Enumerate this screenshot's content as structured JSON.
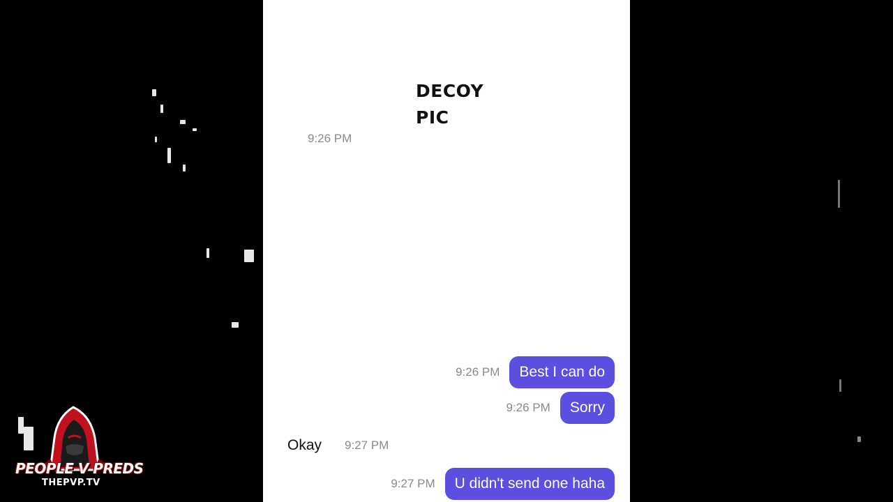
{
  "image_placeholder": {
    "line1": "DECOY",
    "line2": "PIC",
    "time": "9:26 PM"
  },
  "messages": [
    {
      "direction": "out",
      "text": "Best I can do",
      "time": "9:26 PM"
    },
    {
      "direction": "out",
      "text": "Sorry",
      "time": "9:26 PM"
    },
    {
      "direction": "in",
      "text": "Okay",
      "time": "9:27 PM"
    },
    {
      "direction": "out",
      "text": "U didn't send one haha",
      "time": "9:27 PM"
    }
  ],
  "watermark": {
    "title": "PEOPLE V PREDS",
    "subtitle": "THEPVP.TV",
    "icon": "hooded-figure-icon",
    "accent": "#c0111f"
  },
  "colors": {
    "outgoing_bubble": "#5b4fe0",
    "timestamp": "#8a8a8a",
    "chat_background": "#ffffff",
    "side_background": "#000000"
  }
}
